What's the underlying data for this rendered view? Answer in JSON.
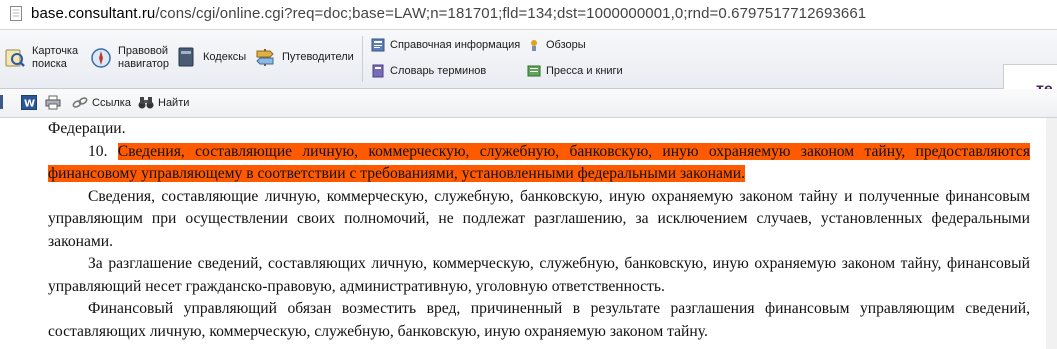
{
  "browser": {
    "url_host": "base.consultant.ru",
    "url_path": "/cons/cgi/online.cgi?req=doc;base=LAW;n=181701;fld=134;dst=1000000001,0;rnd=0.6797517712693661"
  },
  "toolbar": {
    "kartochka_line1": "Карточка",
    "kartochka_line2": "поиска",
    "pravovoy_line1": "Правовой",
    "pravovoy_line2": "навигатор",
    "kodeksy": "Кодексы",
    "putevoditeli": "Путеводители",
    "spravochnaya": "Справочная информация",
    "obzory": "Обзоры",
    "slovar": "Словарь терминов",
    "pressa": "Пресса и книги",
    "ext_label": "те"
  },
  "doc_toolbar": {
    "ssylka": "Ссылка",
    "nayti": "Найти"
  },
  "document": {
    "p0": "Федерации.",
    "p1_num": "10.",
    "p1_highlight": "Сведения, составляющие личную, коммерческую, служебную, банковскую, иную охраняемую законом тайну, предоставляются финансовому управляющему в соответствии с требованиями, установленными федеральными законами.",
    "p2": "Сведения, составляющие личную, коммерческую, служебную, банковскую, иную охраняемую законом тайну и полученные финансовым управляющим при осуществлении своих полномочий, не подлежат разглашению, за исключением случаев, установленных федеральными законами.",
    "p3": "За разглашение сведений, составляющих личную, коммерческую, служебную, банковскую, иную охраняемую законом тайну, финансовый управляющий несет гражданско-правовую, административную, уголовную ответственность.",
    "p4": "Финансовый управляющий обязан возместить вред, причиненный в результате разглашения финансовым управляющим сведений, составляющих личную, коммерческую, служебную, банковскую, иную охраняемую законом тайну."
  },
  "colors": {
    "highlight": "#ff5a00"
  }
}
